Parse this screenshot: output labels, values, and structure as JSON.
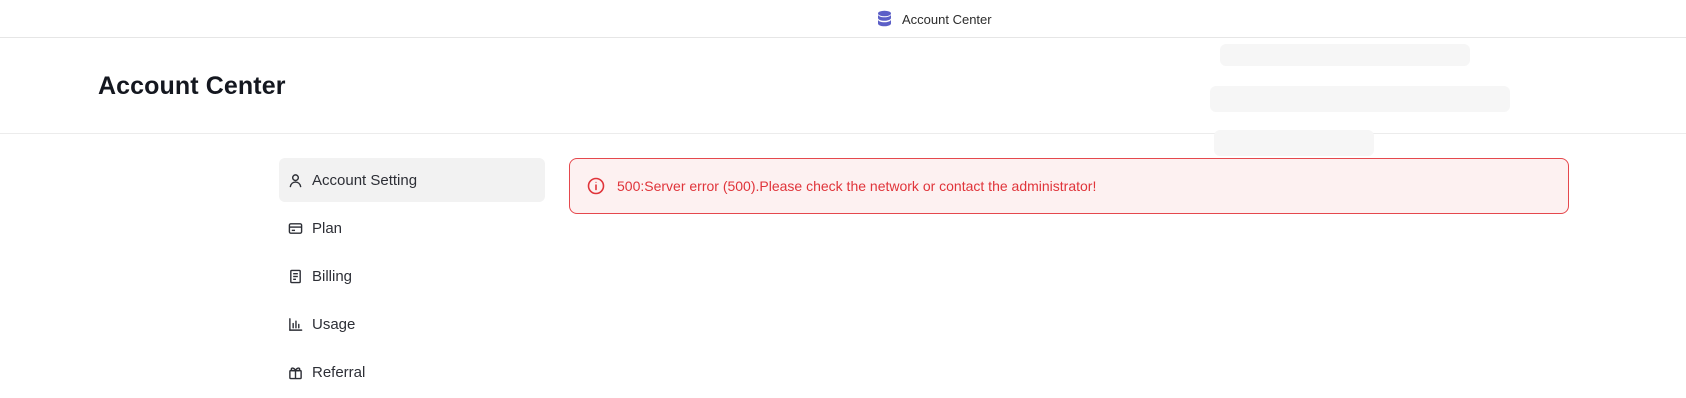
{
  "topbar": {
    "title": "Account Center",
    "icon": "database-icon",
    "icon_color": "#5b5fc7"
  },
  "header": {
    "title": "Account Center"
  },
  "sidebar": {
    "items": [
      {
        "label": "Account Setting",
        "icon": "user-icon",
        "active": true
      },
      {
        "label": "Plan",
        "icon": "credit-card-icon",
        "active": false
      },
      {
        "label": "Billing",
        "icon": "receipt-icon",
        "active": false
      },
      {
        "label": "Usage",
        "icon": "bar-chart-icon",
        "active": false
      },
      {
        "label": "Referral",
        "icon": "gift-icon",
        "active": false
      }
    ]
  },
  "alert": {
    "type": "error",
    "icon": "info-circle-icon",
    "message": "500:Server error (500).Please check the network or contact the administrator!",
    "border_color": "#e5484d",
    "background_color": "#fdf1f1",
    "text_color": "#e0343a"
  }
}
